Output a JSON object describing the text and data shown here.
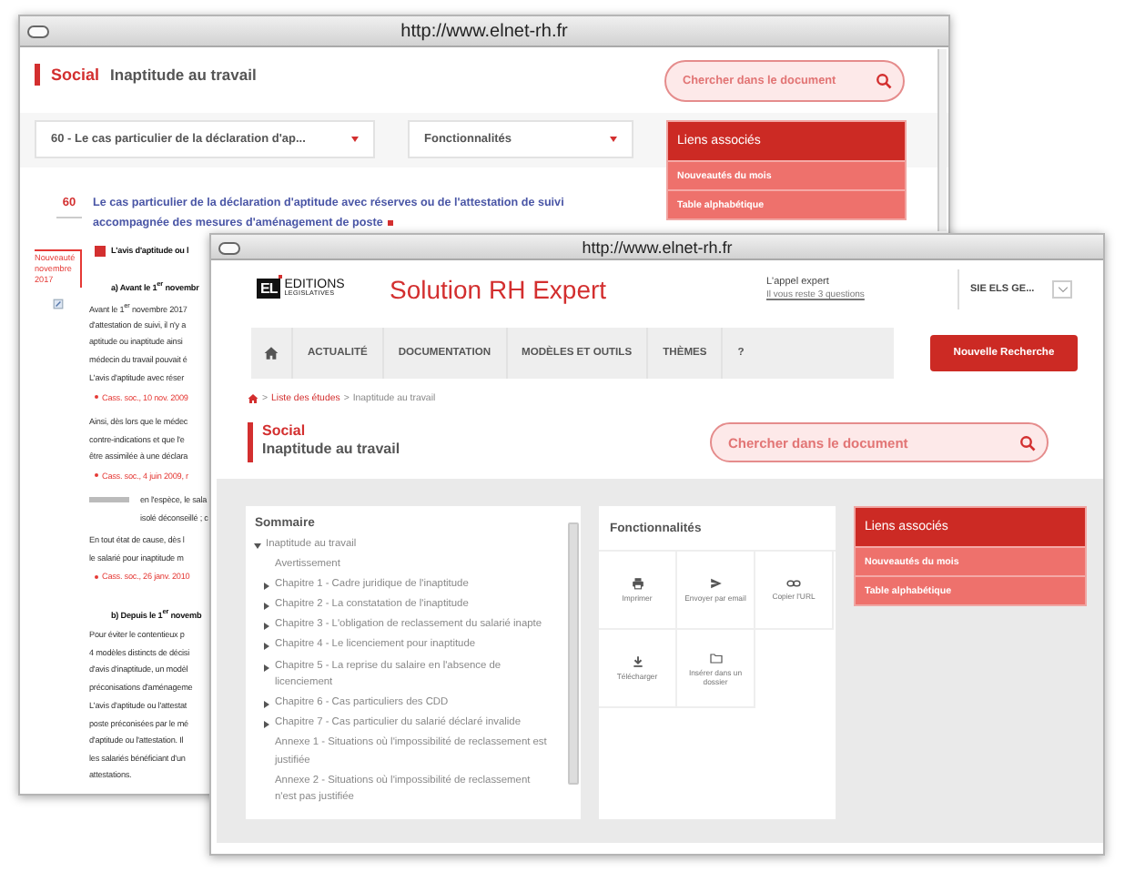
{
  "back_window": {
    "url": "http://www.elnet-rh.fr",
    "section": "Social",
    "title": "Inaptitude au travail",
    "search": {
      "placeholder": "Chercher dans le document"
    },
    "chapter_select": {
      "value": "60 - Le cas particulier de la déclaration d'ap..."
    },
    "features_select": {
      "value": "Fonctionnalités"
    },
    "related_links": {
      "title": "Liens associés",
      "items": [
        "Nouveautés du mois",
        "Table alphabétique"
      ]
    },
    "article": {
      "number": "60",
      "title": "Le cas particulier de la déclaration d'aptitude avec réserves ou de l'attestation de suivi accompagnée des mesures d'aménagement de poste",
      "side_note": "Nouveauté novembre 2017",
      "blocks": [
        {
          "kind": "heading",
          "lines": [
            "L'avis d'aptitude ou l"
          ]
        },
        {
          "kind": "subheading",
          "lines": [
            "a) Avant le 1$^{er}$ novembr"
          ]
        },
        {
          "kind": "text",
          "lines": [
            "Avant le 1$^{er}$ novembre 2017",
            "d'attestation de suivi, il n'y a",
            "aptitude ou inaptitude ainsi",
            "médecin du travail pouvait é"
          ]
        },
        {
          "kind": "text",
          "lines": [
            "L'avis d'aptitude avec réser"
          ]
        },
        {
          "kind": "citation",
          "lines": [
            "Cass. soc., 10 nov. 2009"
          ]
        },
        {
          "kind": "text",
          "lines": [
            "Ainsi, dès lors que le médec",
            "contre-indications et que l'e",
            "être assimilée à une déclara"
          ]
        },
        {
          "kind": "citation",
          "lines": [
            "Cass. soc., 4 juin 2009, r"
          ]
        },
        {
          "kind": "remark",
          "lines": [
            "en l'espèce, le sala",
            "isolé déconseillé ; c"
          ]
        },
        {
          "kind": "text",
          "lines": [
            "En tout état de cause, dès l",
            "le salarié pour inaptitude m"
          ]
        },
        {
          "kind": "citation",
          "lines": [
            "Cass. soc., 26 janv. 2010"
          ]
        },
        {
          "kind": "subheading",
          "lines": [
            "b) Depuis le 1$^{er}$ novemb"
          ]
        },
        {
          "kind": "text",
          "lines": [
            "Pour éviter le contentieux p",
            "4 modèles distincts de décisi",
            "d'avis d'inaptitude, un modèl",
            "préconisations d'aménageme"
          ]
        },
        {
          "kind": "text",
          "lines": [
            "L'avis d'aptitude ou l'attestat",
            "poste préconisées par le mé",
            "d'aptitude ou l'attestation. Il",
            "les salariés bénéficiant d'un",
            "attestations."
          ]
        }
      ]
    }
  },
  "front_window": {
    "url": "http://www.elnet-rh.fr",
    "logo": {
      "mark": "EL",
      "line1": "EDITIONS",
      "line2": "LEGISLATIVES"
    },
    "product": "Solution RH Expert",
    "expert_call": {
      "title": "L'appel expert",
      "link": "Il vous reste 3 questions"
    },
    "account": {
      "name": "SIE ELS GE..."
    },
    "nav": [
      {
        "kind": "home"
      },
      {
        "kind": "link",
        "label": "ACTUALITÉ"
      },
      {
        "kind": "link",
        "label": "DOCUMENTATION"
      },
      {
        "kind": "link",
        "label": "MODÈLES ET OUTILS"
      },
      {
        "kind": "link",
        "label": "THÈMES"
      },
      {
        "kind": "link",
        "label": "?"
      }
    ],
    "new_search_button": "Nouvelle Recherche",
    "breadcrumb": {
      "separator": ">",
      "items": [
        {
          "kind": "home"
        },
        {
          "kind": "link",
          "label": "Liste des études"
        },
        {
          "kind": "current",
          "label": "Inaptitude au travail"
        }
      ]
    },
    "section": "Social",
    "title": "Inaptitude au travail",
    "search": {
      "placeholder": "Chercher dans le document"
    },
    "summary": {
      "title": "Sommaire",
      "tree": [
        {
          "label": "Inaptitude au travail",
          "expanded": true,
          "children": [
            {
              "label": "Avertissement"
            },
            {
              "label": "Chapitre 1 - Cadre juridique de l'inaptitude",
              "expanded": false
            },
            {
              "label": "Chapitre 2 - La constatation de l'inaptitude",
              "expanded": false
            },
            {
              "label": "Chapitre 3 - L'obligation de reclassement du salarié inapte",
              "expanded": false
            },
            {
              "label": "Chapitre 4 - Le licenciement pour inaptitude",
              "expanded": false
            },
            {
              "label": "Chapitre 5 - La reprise du salaire en l'absence de licenciement",
              "expanded": false
            },
            {
              "label": "Chapitre 6 - Cas particuliers des CDD",
              "expanded": false
            },
            {
              "label": "Chapitre 7 - Cas particulier du salarié déclaré invalide",
              "expanded": false
            },
            {
              "label": "Annexe 1 - Situations où l'impossibilité de reclassement est justifiée"
            },
            {
              "label": "Annexe 2 - Situations où l'impossibilité de reclassement n'est pas justifiée"
            }
          ]
        }
      ]
    },
    "features": {
      "title": "Fonctionnalités",
      "items": [
        {
          "kind": "print",
          "label": "Imprimer"
        },
        {
          "kind": "send",
          "label": "Envoyer par email"
        },
        {
          "kind": "link",
          "label": "Copier l'URL"
        },
        {
          "kind": "download",
          "label": "Télécharger"
        },
        {
          "kind": "folder",
          "label": "Insérer dans un dossier"
        }
      ]
    },
    "related_links": {
      "title": "Liens associés",
      "items": [
        "Nouveautés du mois",
        "Table alphabétique"
      ]
    }
  }
}
